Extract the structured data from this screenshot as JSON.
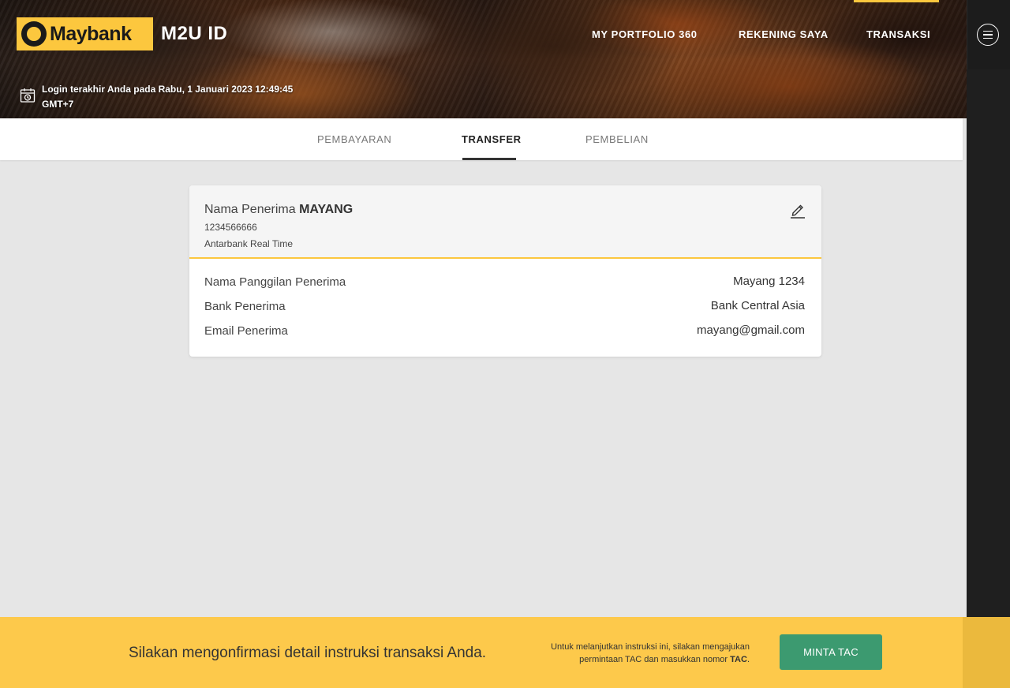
{
  "brand": {
    "logo_text": "Maybank",
    "app_title": "M2U ID"
  },
  "topnav": {
    "items": [
      {
        "label": "MY PORTFOLIO 360"
      },
      {
        "label": "REKENING SAYA"
      },
      {
        "label": "TRANSAKSI",
        "active": true
      }
    ]
  },
  "login": {
    "line1": "Login terakhir Anda pada Rabu, 1 Januari 2023 12:49:45",
    "line2": "GMT+7"
  },
  "subtabs": [
    {
      "label": "PEMBAYARAN"
    },
    {
      "label": "TRANSFER",
      "active": true
    },
    {
      "label": "PEMBELIAN"
    }
  ],
  "card": {
    "recipient_prefix": "Nama Penerima",
    "recipient_name": "MAYANG",
    "account_number": "1234566666",
    "method": "Antarbank Real Time",
    "details": [
      {
        "label": "Nama Panggilan Penerima",
        "value": "Mayang 1234"
      },
      {
        "label": "Bank Penerima",
        "value": "Bank Central Asia"
      },
      {
        "label": "Email Penerima",
        "value": "mayang@gmail.com"
      }
    ]
  },
  "footer": {
    "message": "Silakan mengonfirmasi detail instruksi transaksi Anda.",
    "note_line1": "Untuk melanjutkan instruksi ini, silakan mengajukan",
    "note_line2_prefix": "permintaan TAC dan masukkan nomor ",
    "note_line2_bold": "TAC",
    "note_line2_suffix": ".",
    "button_label": "MINTA TAC"
  },
  "colors": {
    "brand_yellow": "#fcc73e",
    "footer_yellow": "#fdc94b",
    "button_green": "#3c9a70",
    "dark_rail": "#1f1f1f"
  },
  "icons": [
    "maybank-tiger-emblem",
    "calendar-clock-icon",
    "hamburger-menu-icon",
    "pencil-edit-icon"
  ]
}
